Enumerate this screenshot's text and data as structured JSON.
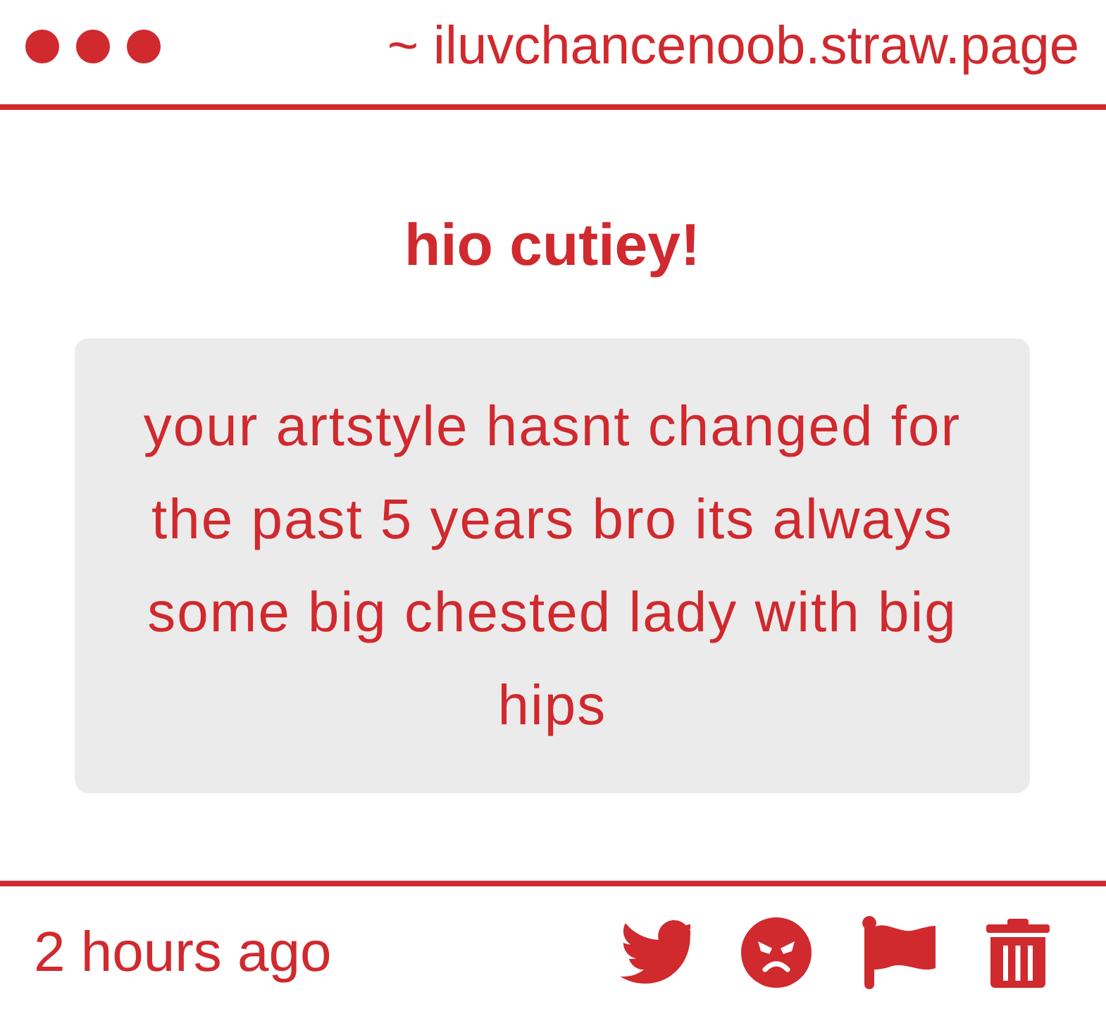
{
  "window": {
    "url": "~ iluvchancenoob.straw.page"
  },
  "message": {
    "title": "hio cutiey!",
    "body": "your artstyle hasnt changed for the past 5 years bro its always some big chested lady with big hips"
  },
  "footer": {
    "time": "2 hours ago"
  }
}
